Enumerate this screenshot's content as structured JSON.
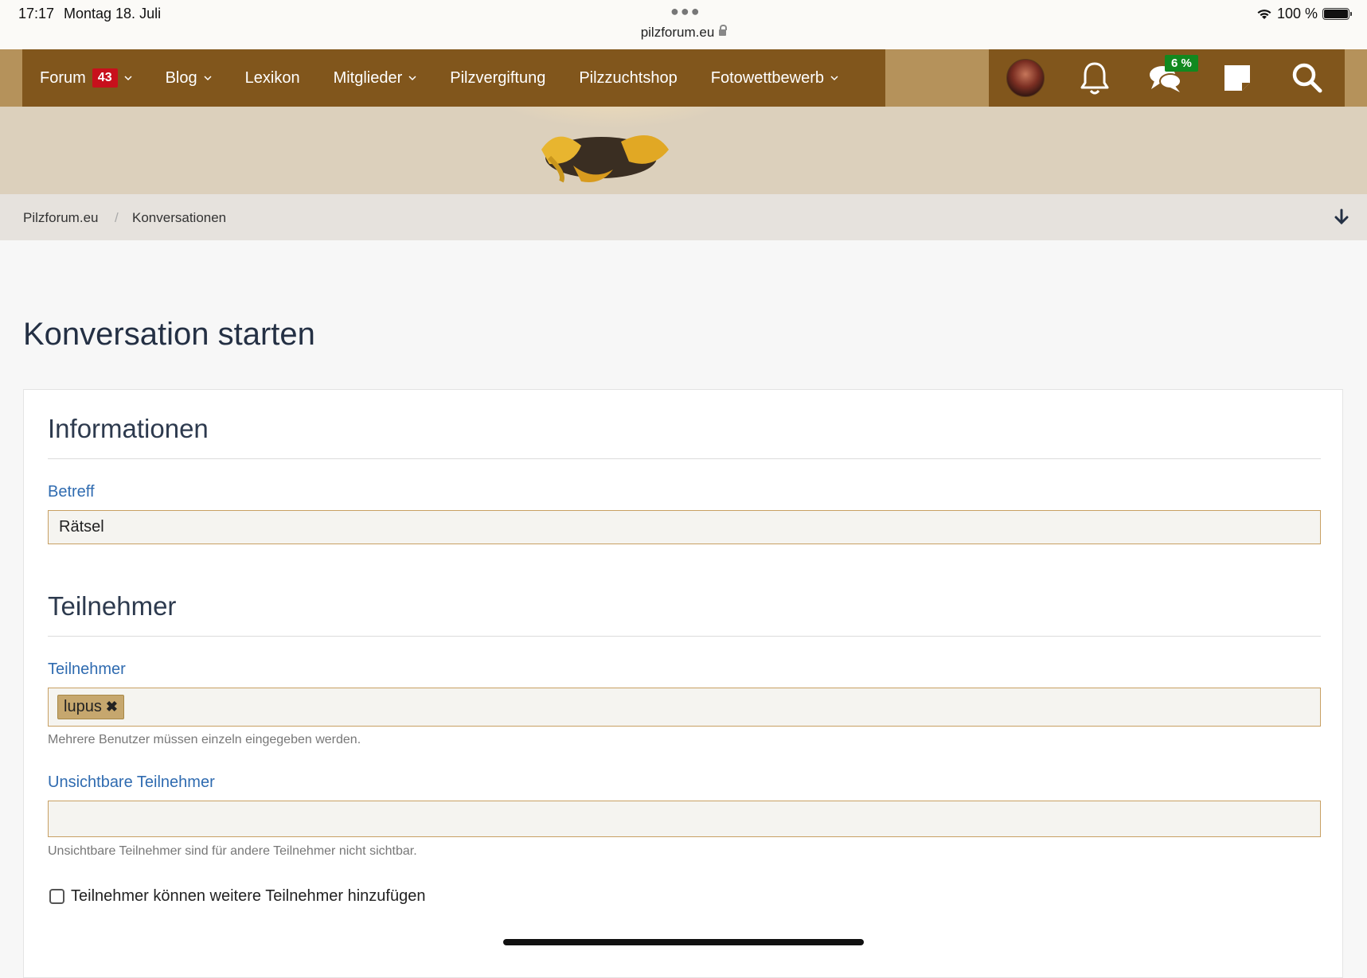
{
  "status_bar": {
    "time": "17:17",
    "date": "Montag 18. Juli",
    "url": "pilzforum.eu",
    "battery": "100 %"
  },
  "nav": {
    "items": [
      {
        "label": "Forum",
        "badge": "43",
        "dropdown": true
      },
      {
        "label": "Blog",
        "dropdown": true
      },
      {
        "label": "Lexikon",
        "dropdown": false
      },
      {
        "label": "Mitglieder",
        "dropdown": true
      },
      {
        "label": "Pilzvergiftung",
        "dropdown": false
      },
      {
        "label": "Pilzzuchtshop",
        "dropdown": false
      },
      {
        "label": "Fotowettbewerb",
        "dropdown": true
      }
    ],
    "conversations_badge": "6 %"
  },
  "breadcrumb": {
    "home": "Pilzforum.eu",
    "separator": "/",
    "current": "Konversationen"
  },
  "page": {
    "title": "Konversation starten",
    "info_section": {
      "title": "Informationen",
      "subject_label": "Betreff",
      "subject_value": "Rätsel"
    },
    "participants_section": {
      "title": "Teilnehmer",
      "participants_label": "Teilnehmer",
      "participant_token": "lupus",
      "participants_hint": "Mehrere Benutzer müssen einzeln eingegeben werden.",
      "invisible_label": "Unsichtbare Teilnehmer",
      "invisible_value": "",
      "invisible_hint": "Unsichtbare Teilnehmer sind für andere Teilnehmer nicht sichtbar.",
      "allow_add_label": "Teilnehmer können weitere Teilnehmer hinzufügen",
      "allow_add_checked": false
    }
  },
  "colors": {
    "nav_bg": "#81561c",
    "nav_outer": "#b5925b",
    "banner_bg": "#dcd0bc",
    "badge_red": "#c8101c",
    "badge_green": "#11891f",
    "label_blue": "#2f6bb0",
    "input_border": "#c8a063",
    "token_bg": "#c6a76e"
  },
  "icons": [
    "wifi-icon",
    "battery-icon",
    "lock-icon",
    "bell-icon",
    "chat-icon",
    "note-icon",
    "search-icon",
    "arrow-down-icon",
    "remove-icon"
  ]
}
